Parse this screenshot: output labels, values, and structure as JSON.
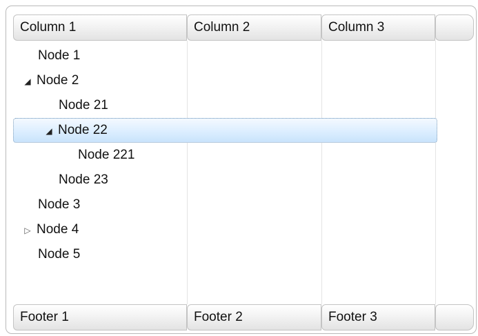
{
  "columns": [
    "Column 1",
    "Column 2",
    "Column 3"
  ],
  "footers": [
    "Footer 1",
    "Footer 2",
    "Footer 3"
  ],
  "tree": [
    {
      "label": "Node 1",
      "expander": ""
    },
    {
      "label": "Node 2",
      "expander": "◢"
    },
    {
      "label": "Node 21",
      "expander": ""
    },
    {
      "label": "Node 22",
      "expander": "◢"
    },
    {
      "label": "Node 221",
      "expander": ""
    },
    {
      "label": "Node 23",
      "expander": ""
    },
    {
      "label": "Node 3",
      "expander": ""
    },
    {
      "label": "Node 4",
      "expander": "▷"
    },
    {
      "label": "Node 5",
      "expander": ""
    }
  ],
  "selected_node": "Node 22",
  "colors": {
    "selection": "#cce4fb",
    "header_border": "#c3c3c3"
  }
}
